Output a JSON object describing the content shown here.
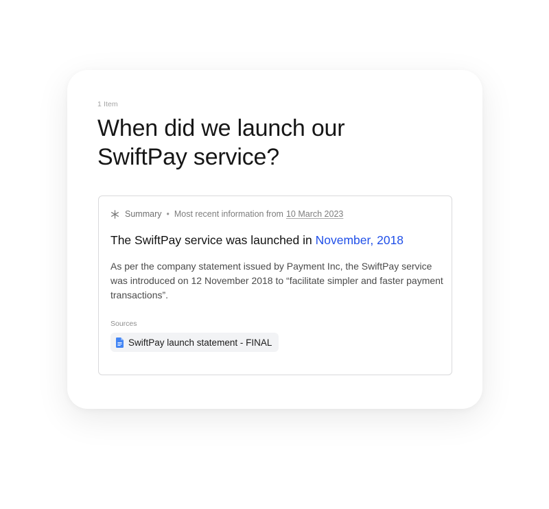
{
  "card": {
    "item_count": "1 Item",
    "question": "When did we launch our SwiftPay service?"
  },
  "answer": {
    "summary_label": "Summary",
    "separator": "•",
    "recency_prefix": "Most recent information from",
    "recency_date": "10 March 2023",
    "headline_prefix": "The SwiftPay service was launched in",
    "headline_highlight": "November, 2018",
    "body": "As per the company statement issued by Payment Inc, the SwiftPay service was introduced on 12 November 2018 to “facilitate simpler and faster payment transactions”.",
    "sources_label": "Sources",
    "sources": [
      {
        "label": "SwiftPay launch statement - FINAL",
        "icon": "google-doc-icon"
      }
    ]
  },
  "colors": {
    "highlight": "#1f4fe8",
    "doc_icon": "#4285f4",
    "chip_background": "#f2f3f5"
  }
}
